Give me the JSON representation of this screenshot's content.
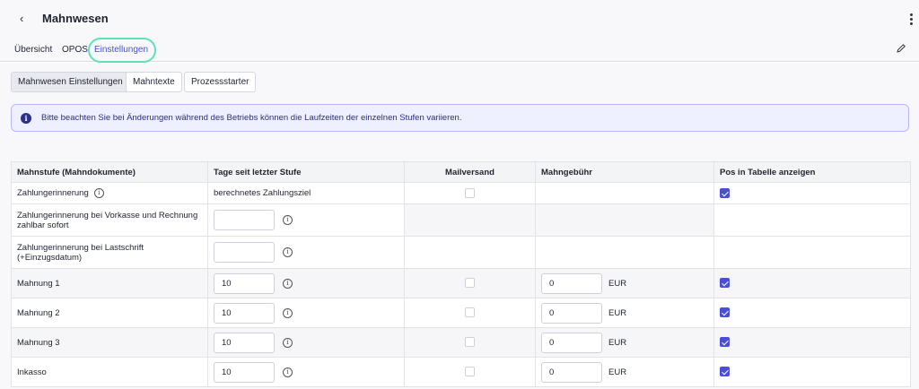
{
  "header": {
    "title": "Mahnwesen"
  },
  "tabs": [
    "Übersicht",
    "OPOS",
    "Einstellungen"
  ],
  "subtabs": [
    "Mahnwesen Einstellungen",
    "Mahntexte",
    "Prozessstarter"
  ],
  "notice": {
    "text": "Bitte beachten Sie bei Änderungen während des Betriebs können die Laufzeiten der einzelnen Stufen variieren."
  },
  "table": {
    "headers": [
      "Mahnstufe (Mahndokumente)",
      "Tage seit letzter Stufe",
      "Mailversand",
      "Mahngebühr",
      "Pos in Tabelle anzeigen"
    ],
    "rows": [
      {
        "label": "Zahlungerinnerung",
        "days_text": "berechnetes Zahlungsziel",
        "mail": false,
        "fee": null,
        "currency": null,
        "show_pos": true
      },
      {
        "label": "Zahlungerinnerung bei Vorkasse und Rechnung zahlbar sofort",
        "days": "",
        "mail": null,
        "fee": null,
        "currency": null,
        "show_pos": null
      },
      {
        "label": "Zahlungerinnerung bei Lastschrift (+Einzugsdatum)",
        "days": "",
        "mail": null,
        "fee": null,
        "currency": null,
        "show_pos": null
      },
      {
        "label": "Mahnung 1",
        "days": "10",
        "mail": false,
        "fee": "0",
        "currency": "EUR",
        "show_pos": true
      },
      {
        "label": "Mahnung 2",
        "days": "10",
        "mail": false,
        "fee": "0",
        "currency": "EUR",
        "show_pos": true
      },
      {
        "label": "Mahnung 3",
        "days": "10",
        "mail": false,
        "fee": "0",
        "currency": "EUR",
        "show_pos": true
      },
      {
        "label": "Inkasso",
        "days": "10",
        "mail": false,
        "fee": "0",
        "currency": "EUR",
        "show_pos": true
      }
    ]
  },
  "colors": {
    "accent": "#4a4fd6",
    "highlight_ring": "#5fe0b8",
    "notice_bg": "#eeefff"
  }
}
